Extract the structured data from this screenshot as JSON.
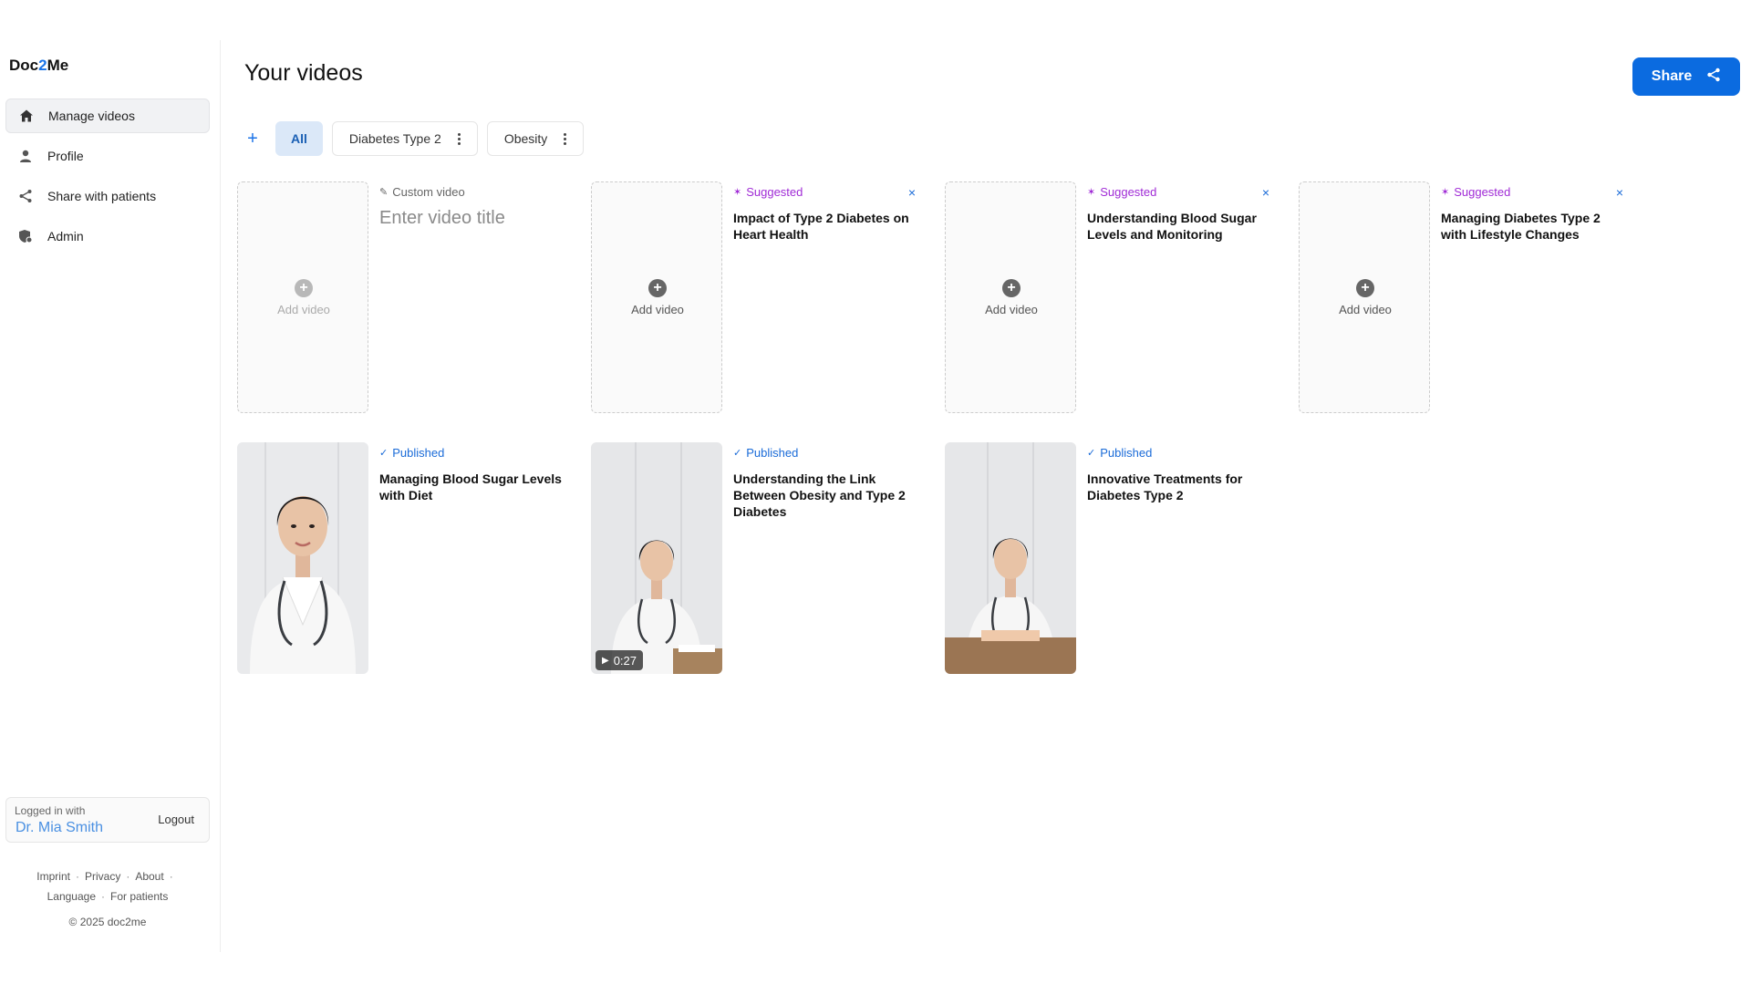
{
  "brand": {
    "name_part1": "Doc",
    "name_part2": "2",
    "name_part3": "Me"
  },
  "sidebar": {
    "items": [
      {
        "label": "Manage videos",
        "icon": "home-icon",
        "active": true
      },
      {
        "label": "Profile",
        "icon": "user-icon",
        "active": false
      },
      {
        "label": "Share with patients",
        "icon": "share-icon",
        "active": false
      },
      {
        "label": "Admin",
        "icon": "admin-shield-icon",
        "active": false
      }
    ],
    "login": {
      "caption": "Logged in with",
      "user": "Dr. Mia Smith",
      "logout_label": "Logout"
    },
    "footer": {
      "links": [
        "Imprint",
        "Privacy",
        "About",
        "Language",
        "For patients"
      ],
      "copyright": "© 2025 doc2me"
    }
  },
  "header": {
    "title": "Your videos",
    "share_label": "Share"
  },
  "tabs": {
    "add_label": "+",
    "items": [
      "All",
      "Diabetes Type 2",
      "Obesity"
    ]
  },
  "cards": {
    "custom": {
      "status": "Custom video",
      "placeholder": "Enter video title",
      "add_label": "Add video"
    },
    "suggested": [
      {
        "status": "Suggested",
        "title": "Impact of Type 2 Diabetes on Heart Health",
        "add_label": "Add video",
        "close": "×"
      },
      {
        "status": "Suggested",
        "title": "Understanding Blood Sugar Levels and Monitoring",
        "add_label": "Add video",
        "close": "×"
      },
      {
        "status": "Suggested",
        "title": "Managing Diabetes Type 2 with Lifestyle Changes",
        "add_label": "Add video",
        "close": "×"
      }
    ],
    "published": [
      {
        "status": "Published",
        "title": "Managing Blood Sugar Levels with Diet",
        "duration": ""
      },
      {
        "status": "Published",
        "title": "Understanding the Link Between Obesity and Type 2 Diabetes",
        "duration": "0:27"
      },
      {
        "status": "Published",
        "title": "Innovative Treatments for Diabetes Type 2",
        "duration": ""
      }
    ]
  },
  "colors": {
    "accent": "#0b6be0",
    "suggested": "#a02bd6",
    "published": "#1a6bd8"
  }
}
